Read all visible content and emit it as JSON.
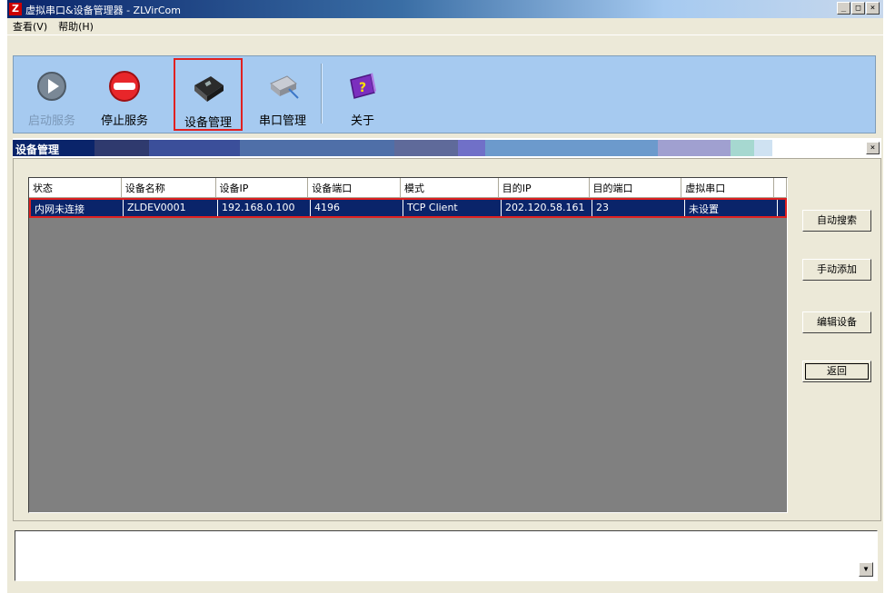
{
  "window": {
    "logo": "Z",
    "title": "虚拟串口&设备管理器 - ZLVirCom",
    "buttons": [
      "_",
      "□",
      "×"
    ]
  },
  "menu": [
    "查看(V)",
    "帮助(H)"
  ],
  "toolbar": {
    "buttons": [
      {
        "label": "启动服务",
        "icon": "play-icon",
        "enabled": false,
        "active": false
      },
      {
        "label": "停止服务",
        "icon": "stop-icon",
        "enabled": true,
        "active": false
      },
      {
        "label": "设备管理",
        "icon": "device-icon",
        "enabled": true,
        "active": true
      },
      {
        "label": "串口管理",
        "icon": "serial-port-icon",
        "enabled": true,
        "active": false
      },
      {
        "label": "关于",
        "icon": "about-icon",
        "enabled": true,
        "active": false
      }
    ]
  },
  "panel": {
    "title": "设备管理",
    "close": "×",
    "columns": [
      "状态",
      "设备名称",
      "设备IP",
      "设备端口",
      "模式",
      "目的IP",
      "目的端口",
      "虚拟串口"
    ],
    "rows": [
      [
        "内网未连接",
        "ZLDEV0001",
        "192.168.0.100",
        "4196",
        "TCP Client",
        "202.120.58.161",
        "23",
        "未设置"
      ]
    ],
    "actions": [
      "自动搜索",
      "手动添加",
      "编辑设备",
      "返回"
    ]
  },
  "status": {
    "scroll_arrow": "▼"
  },
  "colors": {
    "titlebar": "#0a246a",
    "toolbar_bg": "#a6caf0",
    "selection": "#0a246a",
    "highlight_border": "#e02020",
    "grid_bg": "#808080"
  }
}
